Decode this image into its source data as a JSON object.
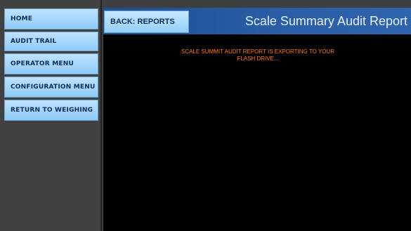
{
  "sidebar": {
    "items": [
      {
        "label": "HOME"
      },
      {
        "label": "AUDIT TRAIL"
      },
      {
        "label": "OPERATOR MENU"
      },
      {
        "label": "CONFIGURATION MENU"
      },
      {
        "label": "RETURN TO WEIGHING"
      }
    ]
  },
  "header": {
    "back_label": "BACK: REPORTS",
    "title": "Scale Summary Audit Report"
  },
  "main": {
    "status_line1": "SCALE SUMMIT AUDIT REPORT IS EXPORTING TO YOUR",
    "status_line2": "FLASH DRIVE..."
  },
  "colors": {
    "nav_button": "#8ecbf7",
    "header_bar": "#2a5ea6",
    "status_text": "#ff7a1a",
    "background": "#000000"
  }
}
